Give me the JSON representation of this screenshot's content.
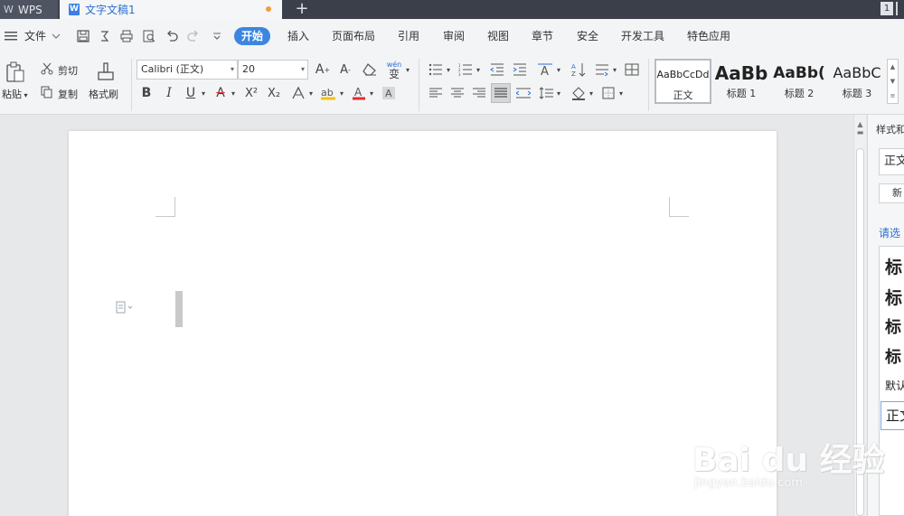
{
  "titlebar": {
    "app_tab": "WPS",
    "doc_tab": "文字文稿1",
    "add_tab": "+",
    "window_number": "1"
  },
  "menubar": {
    "file_menu": "文件",
    "tabs": [
      "开始",
      "插入",
      "页面布局",
      "引用",
      "审阅",
      "视图",
      "章节",
      "安全",
      "开发工具",
      "特色应用"
    ],
    "active_tab": "开始"
  },
  "ribbon": {
    "paste": "粘贴",
    "cut": "剪切",
    "copy": "复制",
    "format_painter": "格式刷",
    "font_name": "Calibri (正文)",
    "font_size": "20",
    "bold": "B",
    "italic": "I",
    "underline": "U",
    "strike": "A",
    "superscript": "X²",
    "subscript": "X₂",
    "phonetic_top": "wén",
    "phonetic_char": "变",
    "styles": [
      {
        "sample": "AaBbCcDd",
        "name": "正文"
      },
      {
        "sample": "AaBb",
        "name": "标题 1"
      },
      {
        "sample": "AaBb(",
        "name": "标题 2"
      },
      {
        "sample": "AaBbC",
        "name": "标题 3"
      }
    ]
  },
  "rpane": {
    "title": "样式和",
    "current_style": "正文",
    "new_button": "新",
    "filter_link": "请选",
    "style_list": [
      "标",
      "标",
      "标",
      "标",
      "默认",
      "正文"
    ]
  },
  "watermark": {
    "brand": "Bai du 经验",
    "url": "jingyan.baidu.com"
  },
  "colors": {
    "accent": "#3d86e0",
    "titlebar": "#3b3f4a",
    "modified_dot": "#f39c3c"
  }
}
